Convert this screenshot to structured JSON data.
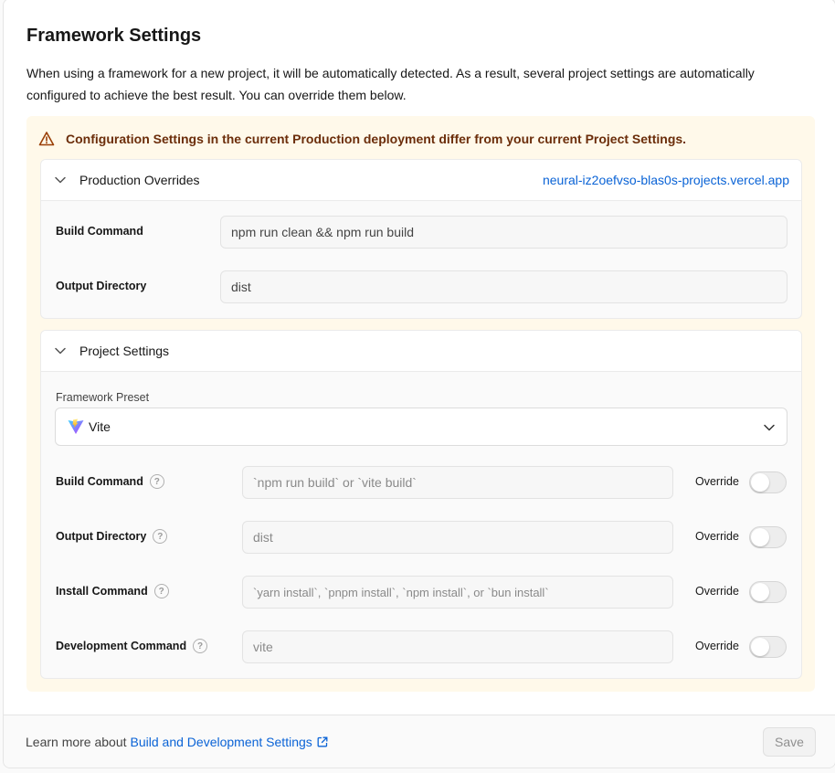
{
  "header": {
    "title": "Framework Settings",
    "description": "When using a framework for a new project, it will be automatically detected. As a result, several project settings are automatically configured to achieve the best result. You can override them below."
  },
  "warning": {
    "icon": "warning-triangle-icon",
    "message": "Configuration Settings in the current Production deployment differ from your current Project Settings.",
    "color": "#6b2d0a",
    "background": "#fff9ea"
  },
  "production_overrides": {
    "title": "Production Overrides",
    "deployment_link": "neural-iz2oefvso-blas0s-projects.vercel.app",
    "fields": [
      {
        "label": "Build Command",
        "value": "npm run clean && npm run build"
      },
      {
        "label": "Output Directory",
        "value": "dist"
      }
    ]
  },
  "project_settings": {
    "title": "Project Settings",
    "framework_preset_label": "Framework Preset",
    "framework_preset_value": "Vite",
    "override_label": "Override",
    "fields": [
      {
        "label": "Build Command",
        "placeholder": "`npm run build` or `vite build`",
        "override": false
      },
      {
        "label": "Output Directory",
        "placeholder": "dist",
        "override": false
      },
      {
        "label": "Install Command",
        "placeholder": "`yarn install`, `pnpm install`, `npm install`, or `bun install`",
        "override": false
      },
      {
        "label": "Development Command",
        "placeholder": "vite",
        "override": false
      }
    ]
  },
  "footer": {
    "learn_more_text": "Learn more about",
    "learn_more_link": "Build and Development Settings",
    "save_label": "Save"
  },
  "colors": {
    "link": "#0a63d6",
    "accent_vite": "#a855f7"
  }
}
